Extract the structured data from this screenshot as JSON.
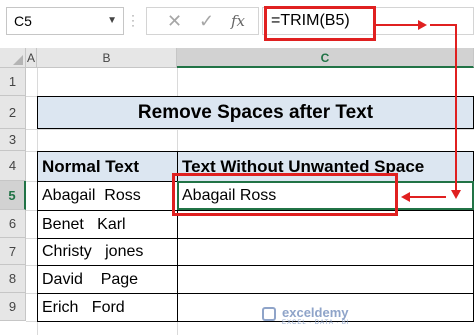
{
  "formula_bar": {
    "name_box": "C5",
    "cancel_icon": "✕",
    "enter_icon": "✓",
    "fx_label": "fx",
    "formula": "=TRIM(B5)"
  },
  "columns": [
    "A",
    "B",
    "C"
  ],
  "rows": [
    "1",
    "2",
    "3",
    "4",
    "5",
    "6",
    "7",
    "8",
    "9"
  ],
  "sheet": {
    "title": "Remove Spaces after Text",
    "table": {
      "headers": [
        "Normal Text",
        "Text Without Unwanted Space"
      ],
      "rows": [
        [
          "Abagail  Ross",
          "Abagail Ross"
        ],
        [
          "Benet   Karl",
          ""
        ],
        [
          "Christy   jones",
          ""
        ],
        [
          "David    Page",
          ""
        ],
        [
          "Erich   Ford",
          ""
        ]
      ]
    }
  },
  "watermark": {
    "name": "exceldemy",
    "tagline": "EXCEL · DATA · BI"
  },
  "colors": {
    "highlight": "#e02020",
    "header_fill": "#dce6f1",
    "selection": "#217346"
  }
}
